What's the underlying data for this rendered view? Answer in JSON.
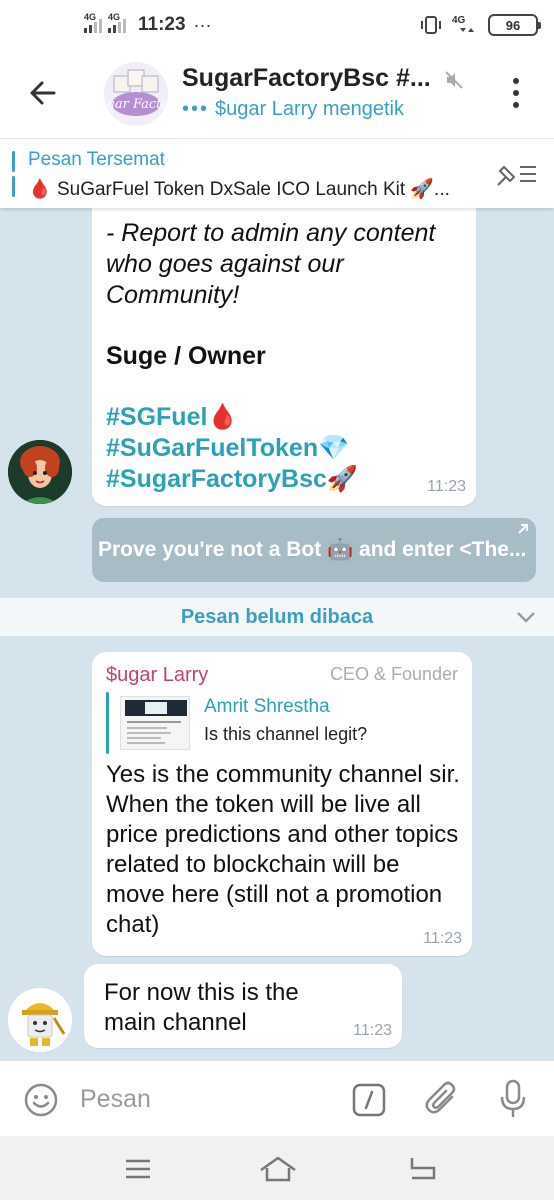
{
  "status_bar": {
    "net1": "4G",
    "net2": "4G",
    "time": "11:23",
    "dots": "···",
    "net3": "4G",
    "battery": "96"
  },
  "header": {
    "title": "SugarFactoryBsc #...",
    "typing_dots": "•••",
    "subtitle": "$ugar Larry mengetik",
    "group_logo_text": "Sugar Factory"
  },
  "pinned": {
    "label": "Pesan Tersemat",
    "icon": "🩸",
    "text": "SuGarFuel Token DxSale ICO Launch Kit 🚀..."
  },
  "messages": {
    "m1": {
      "line1": "- Report to admin any content",
      "line2": "who goes against our",
      "line3": "Community!",
      "signature": "Suge / Owner",
      "tag1": "#SGFuel🩸",
      "tag2": "#SuGarFuelToken💎",
      "tag3": "#SugarFactoryBsc🚀",
      "time": "11:23"
    },
    "bot_button": "Prove you're not a Bot 🤖 and enter <The...",
    "unread_divider": "Pesan belum dibaca",
    "m2": {
      "sender": "$ugar Larry",
      "role": "CEO & Founder",
      "reply_name": "Amrit Shrestha",
      "reply_text": "Is this channel legit?",
      "body": "Yes is the community channel sir. When the token will be live all price predictions and other topics related to blockchain will be move here (still not a promotion chat)",
      "time": "11:23"
    },
    "m3": {
      "body": "For now this is the main channel",
      "time": "11:23"
    }
  },
  "input": {
    "placeholder": "Pesan"
  },
  "colors": {
    "accent": "#3a9fc5",
    "hashtag": "#2aa1b5",
    "sender": "#c4407a",
    "chat_bg": "#d5e4ec",
    "bot_button": "#a7bcc4"
  }
}
